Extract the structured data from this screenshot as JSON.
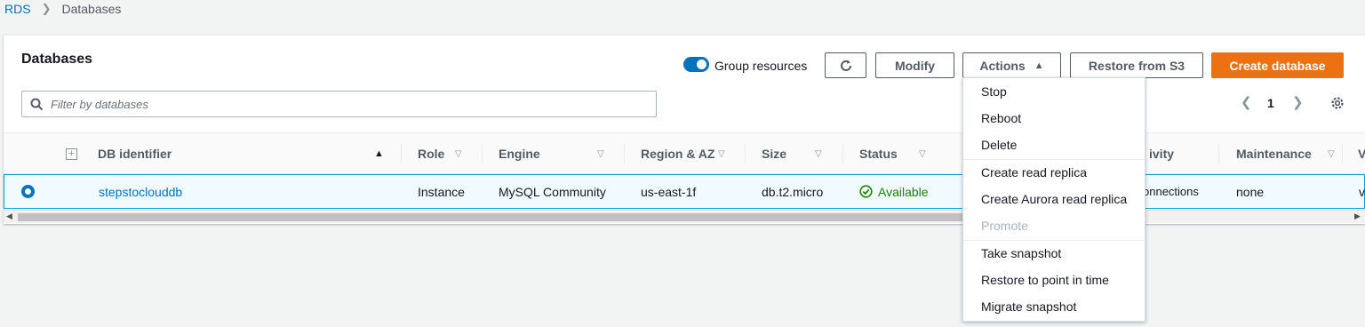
{
  "breadcrumb": {
    "root": "RDS",
    "current": "Databases"
  },
  "panel": {
    "title": "Databases",
    "group_resources_label": "Group resources",
    "buttons": {
      "modify": "Modify",
      "actions": "Actions",
      "restore": "Restore from S3",
      "create": "Create database"
    },
    "search_placeholder": "Filter by databases",
    "page_number": "1"
  },
  "table": {
    "columns": {
      "db_identifier": "DB identifier",
      "role": "Role",
      "engine": "Engine",
      "region": "Region & AZ",
      "size": "Size",
      "status": "Status",
      "activity": "ivity",
      "maintenance": "Maintenance",
      "next": "V"
    },
    "rows": [
      {
        "db_identifier": "stepstoclouddb",
        "role": "Instance",
        "engine": "MySQL Community",
        "region": "us-east-1f",
        "size": "db.t2.micro",
        "status": "Available",
        "activity": "onnections",
        "maintenance": "none",
        "next": "v"
      }
    ]
  },
  "actions_menu": {
    "items": [
      {
        "label": "Stop",
        "disabled": false
      },
      {
        "label": "Reboot",
        "disabled": false
      },
      {
        "label": "Delete",
        "disabled": false
      },
      {
        "label": "Create read replica",
        "disabled": false
      },
      {
        "label": "Create Aurora read replica",
        "disabled": false
      },
      {
        "label": "Promote",
        "disabled": true
      },
      {
        "label": "Take snapshot",
        "disabled": false
      },
      {
        "label": "Restore to point in time",
        "disabled": false
      },
      {
        "label": "Migrate snapshot",
        "disabled": false
      }
    ]
  },
  "colors": {
    "primary": "#ec7211",
    "link": "#0073bb",
    "success": "#1d8102",
    "selected_row": "#f1faff"
  }
}
